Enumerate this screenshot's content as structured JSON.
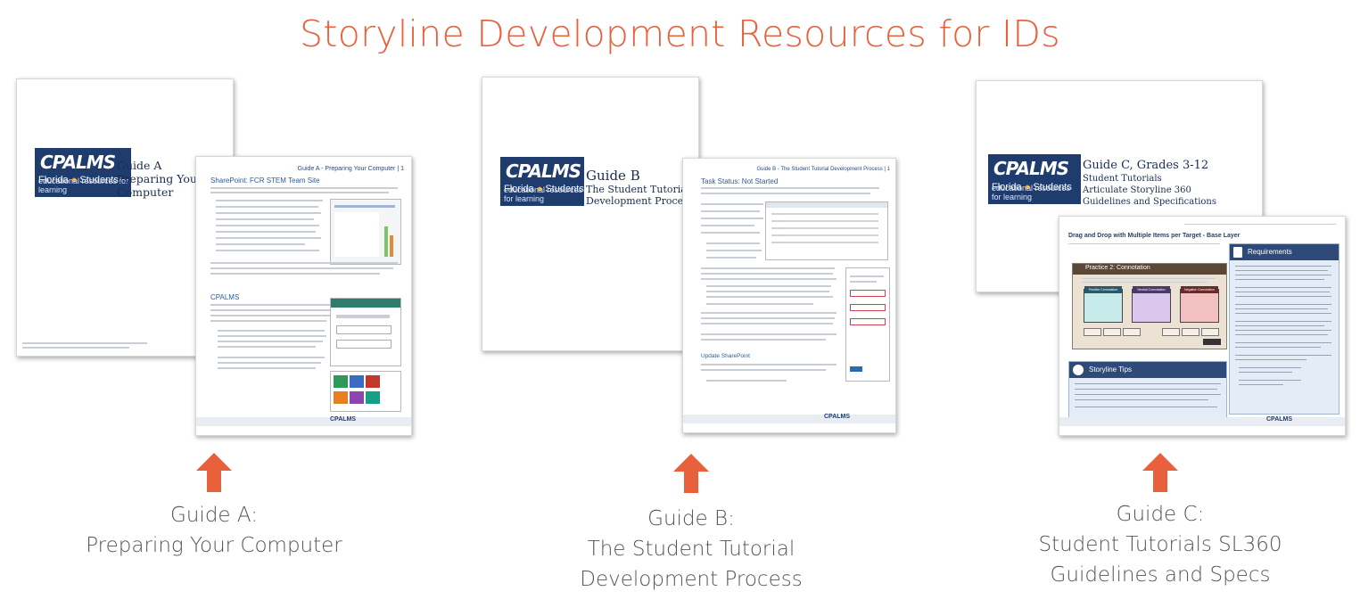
{
  "title": "Storyline Development Resources for IDs",
  "colors": {
    "accent": "#e8613c",
    "navy": "#1f3c6e",
    "arrow": "#e8613c"
  },
  "logo": {
    "word": "CPALMS",
    "state": "Florida",
    "students": "Students",
    "tagline": "educational resources for learning"
  },
  "guides": [
    {
      "cover": {
        "line1": "Guide A",
        "line2": "Preparing Your",
        "line3": "Computer"
      },
      "inner": {
        "header": "Guide A - Preparing Your Computer | 1",
        "section1": "SharePoint: FCR STEM Team Site",
        "section2": "CPALMS"
      },
      "caption": {
        "line1": "Guide A:",
        "line2": "Preparing Your Computer"
      }
    },
    {
      "cover": {
        "line1": "Guide B",
        "line2": "The Student Tutorial",
        "line3": "Development Process"
      },
      "inner": {
        "header": "Guide B - The Student Tutorial Development Process | 1",
        "section1": "Task Status: Not Started",
        "section2": "Update SharePoint"
      },
      "caption": {
        "line1": "Guide B:",
        "line2": "The Student Tutorial",
        "line3": "Development Process"
      }
    },
    {
      "cover": {
        "line1": "Guide C, Grades 3-12",
        "line2": "Student Tutorials",
        "line3": "Articulate Storyline 360",
        "line4": "Guidelines and Specifications"
      },
      "inner": {
        "header": "Drag and Drop with Multiple Items per Target - Base Layer",
        "requirements": "Requirements",
        "tips": "Storyline Tips",
        "practice": "Practice 2: Connotation",
        "col1": "Positive Connotation",
        "col2": "Neutral Connotation",
        "col3": "Negative Connotation"
      },
      "caption": {
        "line1": "Guide C:",
        "line2": "Student Tutorials SL360",
        "line3": "Guidelines and Specs"
      }
    }
  ]
}
